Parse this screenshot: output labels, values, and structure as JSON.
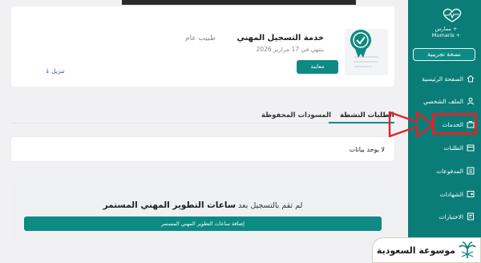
{
  "sidebar": {
    "brand_top": "ممارس +",
    "brand_bottom": "Mumaris +",
    "trial_label": "نسخة تجريبية",
    "items": [
      {
        "label": "الصفحة الرئيسية",
        "icon": "home-icon"
      },
      {
        "label": "الملف الشخصي",
        "icon": "user-icon"
      },
      {
        "label": "الخدمات",
        "icon": "services-icon"
      },
      {
        "label": "الطلبات",
        "icon": "requests-icon"
      },
      {
        "label": "المدفوعات",
        "icon": "payments-icon"
      },
      {
        "label": "الشهادات",
        "icon": "certificates-icon"
      },
      {
        "label": "الاختبارات",
        "icon": "exams-icon"
      }
    ]
  },
  "service": {
    "title": "خدمة التسجيل المهني",
    "subtitle": "طبيب عام",
    "expiry": "ينتهي في 17 مرارير 2026",
    "view_label": "معاينة",
    "download_label": "تنزيل"
  },
  "tabs": {
    "active": "الطلبات النشطة",
    "drafts": "المسودات المحفوظة"
  },
  "empty_message": "لا يوجد بيانات",
  "cpd": {
    "prefix": "لم تقم بالتسجيل بعد",
    "highlight": "ساعات التطوير المهني المستمر",
    "button_label": "إضافة ساعات التطوير المهني المستمر"
  },
  "watermark": {
    "text": "موسوعة السعودية"
  },
  "colors": {
    "brand": "#0b7d78",
    "accent": "#0d8a84",
    "highlight": "#e0222a"
  }
}
